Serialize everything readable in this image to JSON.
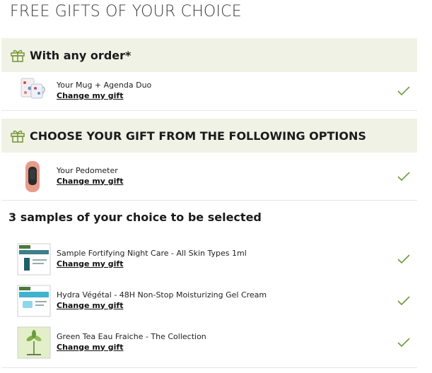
{
  "page_title": "FREE GIFTS OF YOUR CHOICE",
  "sections": {
    "any_order": {
      "title": "With any order*",
      "icon": "gift-icon"
    },
    "choose": {
      "title": "CHOOSE YOUR GIFT FROM THE FOLLOWING OPTIONS",
      "icon": "gift-icon"
    }
  },
  "samples_heading": "3 samples of your choice to be selected",
  "items": {
    "mug": {
      "name": "Your Mug + Agenda Duo",
      "link": "Change my gift",
      "selected": true
    },
    "pedometer": {
      "name": "Your Pedometer",
      "link": "Change my gift",
      "selected": true
    },
    "sample1": {
      "name": "Sample Fortifying Night Care - All Skin Types 1ml",
      "link": "Change my gift",
      "selected": true
    },
    "sample2": {
      "name": "Hydra Végétal - 48H Non-Stop Moisturizing Gel Cream",
      "link": "Change my gift",
      "selected": true
    },
    "sample3": {
      "name": "Green Tea Eau Fraiche - The Collection",
      "link": "Change my gift",
      "selected": true
    }
  },
  "colors": {
    "section_bg": "#f1f2e6",
    "check": "#6f9a3c",
    "gift_icon": "#7a9a3a"
  }
}
